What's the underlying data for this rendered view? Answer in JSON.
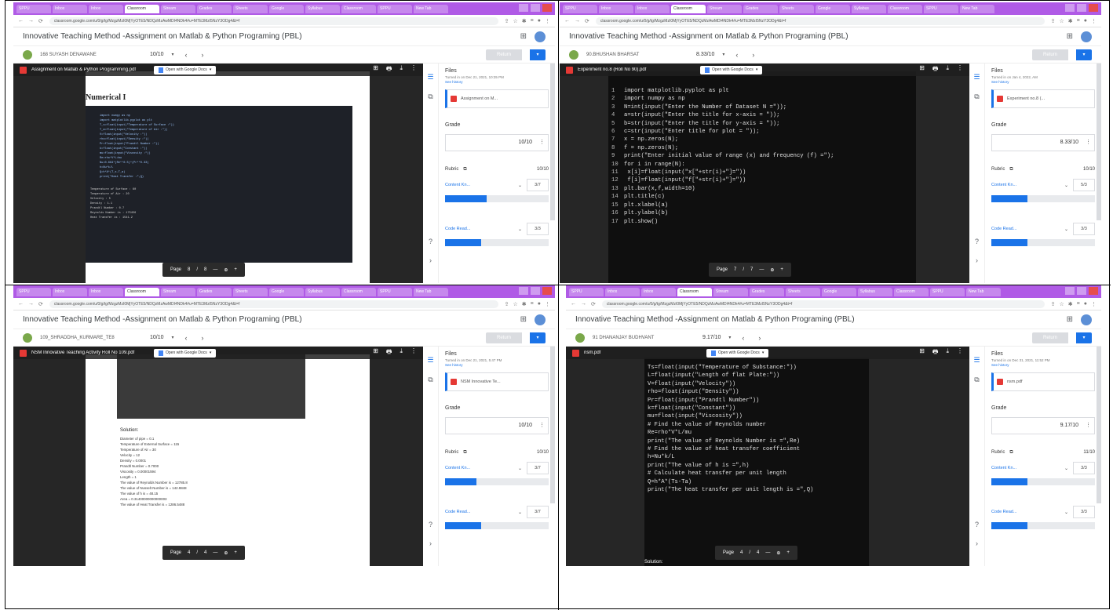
{
  "browser": {
    "tab_labels": [
      "SPPU",
      "Inbox",
      "Inbox",
      "Classroom",
      "Stream",
      "Grades",
      "Sheets",
      "Google",
      "Syllabus",
      "Classroom",
      "SPPU",
      "New Tab"
    ],
    "url": "classroom.google.com/u/0/g/tg/MzgzMzI0MjYyOTE5/NDQzMzAwMDI4NDk4#u=MTE3MzI5NzY3ODg4&t=f",
    "nav_icons": [
      "←",
      "→",
      "⟳"
    ],
    "toolbar_icons": [
      "⇪",
      "☆",
      "✱",
      "≡",
      "●",
      "⋮"
    ]
  },
  "classroom": {
    "title": "Innovative Teaching Method -Assignment on Matlab & Python Programing (PBL)",
    "apps_icon": "⊞",
    "return_label": "Return",
    "return_arrow": "▾",
    "prev": "‹",
    "next": "›",
    "caret": "▾",
    "docs_button": "Open with Google Docs",
    "docs_caret": "▾",
    "viewer_icons": [
      "⊞",
      "🖶",
      "⤓",
      "⋮"
    ],
    "files_heading": "Files",
    "see_history": "See history",
    "grade_heading": "Grade",
    "rubric_heading": "Rubric",
    "rubric_icon": "⧉",
    "content_label": "Content Kn...",
    "code_label": "Code Read...",
    "crit_caret": "⌄",
    "page_label": "Page",
    "page_sep": "/",
    "zoom_minus": "—",
    "zoom_icon": "⊕",
    "zoom_plus": "+",
    "more_dots": "⋮",
    "side_icons": [
      "☰",
      "⧉",
      "?",
      "›"
    ]
  },
  "panes": [
    {
      "student": "168 SUYASH DENAWANE",
      "score": "10/10",
      "file_name": "Assignment on Matlab & Python Programming.pdf",
      "card_file": "Assignment on M...",
      "turned_in": "Turned in on Dec 21, 2021, 10:35 PM",
      "grade_value": "10/10",
      "rubric_total": "10/10",
      "content_score": "3/7",
      "code_score": "3/3",
      "content_fill": 0.4,
      "page_num": "8",
      "page_total": "8",
      "doc_title": "Numerical I",
      "code_lines": [
        "import numpy as np",
        "import matplotlib.pyplot as plt",
        "T_s=float(input(\"Temperature of Surface :\"))",
        "T_a=float(input(\"Temperature of Air :\"))",
        "V=float(input(\"Velocity :\"))",
        "rho=float(input(\"Density :\"))",
        "Pr=float(input(\"Prandtl Number :\"))",
        "k=float(input(\"Constant :\"))",
        "mu=float(input(\"Viscosity :\"))",
        "Re=rho*V*L/mu",
        "Nu=0.664*(Re**0.5)*(Pr**0.33)",
        "h=Nu*k/L",
        "Q=h*A*(T_s-T_a)",
        "print(\"Heat Transfer :\",Q)"
      ],
      "output_lines": [
        "Temperature of Surface : 60",
        "Temperature of Air : 20",
        "Velocity : 5",
        "Density : 1.1",
        "Prandtl Number : 0.7",
        "Reynolds Number is : 175456",
        "Heat Transfer is : 1541.2"
      ]
    },
    {
      "student": "90.BHUSHAN BHARSAT",
      "score": "8.33/10",
      "file_name": "Experiment no.8 (Roll No 90).pdf",
      "card_file": "Experiment no.8 (...",
      "turned_in": "Turned in on Jan 4, 2022, AM",
      "grade_value": "8.33/10",
      "rubric_total": "10/10",
      "content_score": "5/3",
      "code_score": "3/3",
      "content_fill": 0.35,
      "page_num": "7",
      "page_total": "7",
      "photo_lines": [
        "import matplotlib.pyplot as plt",
        "import numpy as np",
        "N=int(input(\"Enter the Number of Dataset N =\"));",
        "a=str(input(\"Enter the title for x-axis = \"));",
        "b=str(input(\"Enter the title for y-axis = \"));",
        "c=str(input(\"Enter title for plot = \"));",
        "x = np.zeros(N);",
        "f = np.zeros(N);",
        "print(\"Enter initial value of range (x) and frequency (f) =\");",
        "for i in range(N):",
        "    x[i]=float(input(\"x[\"+str(i)+\"]=\"))",
        "    f[i]=float(input(\"f[\"+str(i)+\"]=\"))",
        "plt.bar(x,f,width=10)",
        "plt.title(c)",
        "plt.xlabel(a)",
        "plt.ylabel(b)",
        "plt.show()"
      ]
    },
    {
      "student": "109_SHRADDHA_KURMARE_TE8",
      "score": "10/10",
      "file_name": "NSM Innovative Teaching Activity Roll No 109.pdf",
      "card_file": "NSM Innovative Te...",
      "turned_in": "Turned in on Dec 21, 2021, 5:47 PM",
      "grade_value": "10/10",
      "rubric_total": "10/10",
      "content_score": "3/7",
      "code_score": "3/7",
      "content_fill": 0.3,
      "page_num": "4",
      "page_total": "4",
      "solution_label": "Solution:",
      "solution_lines": [
        "Diameter of pipe = 0.1",
        "Temperature of External Surface = 115",
        "Temperature of Air = 30",
        "Velocity = 12",
        "Density = 0.0001",
        "Prandtl Number = 0.7000",
        "Viscosity = 0.00001594",
        "Length = 1",
        "The value of Reynolds Number is = 12785.8",
        "The value of Nusselt Number is = 142.9848",
        "The value of h is = 48.15",
        "Area = 0.31400000000000003",
        "The value of Heat Transfer is = 1286.5488"
      ]
    },
    {
      "student": "91 DHANANJAY BUDHVANT",
      "score": "9.17/10",
      "file_name": "nsm.pdf",
      "card_file": "nsm.pdf",
      "turned_in": "Turned in on Dec 31, 2021, 11:52 PM",
      "grade_value": "9.17/10",
      "rubric_total": "11/10",
      "content_score": "3/3",
      "code_score": "3/3",
      "content_fill": 0.35,
      "page_num": "4",
      "page_total": "4",
      "photo_lines": [
        "Ts=float(input(\"Temperature of Substance:\"))",
        "L=float(input(\"Length of flat Plate:\"))",
        "V=float(input(\"Velocity\"))",
        "rho=float(input(\"Density\"))",
        "Pr=float(input(\"Prandtl Number\"))",
        "k=float(input(\"Constant\"))",
        "mu=float(input(\"Viscosity\"))",
        "",
        "# Find the value of Reynolds number",
        "Re=rho*V*L/mu",
        "print(\"The value of Reynolds Number is =\",Re)",
        "",
        "# Find the value of heat transfer coefficient",
        "h=Nu*k/L",
        "print(\"The value of h is =\",h)",
        "",
        "# Calculate heat transfer per unit length",
        "Q=h*A*(Ts-Ta)",
        "print(\"The heat transfer per unit length is =\",Q)"
      ],
      "solution_label": "Solution:"
    }
  ]
}
